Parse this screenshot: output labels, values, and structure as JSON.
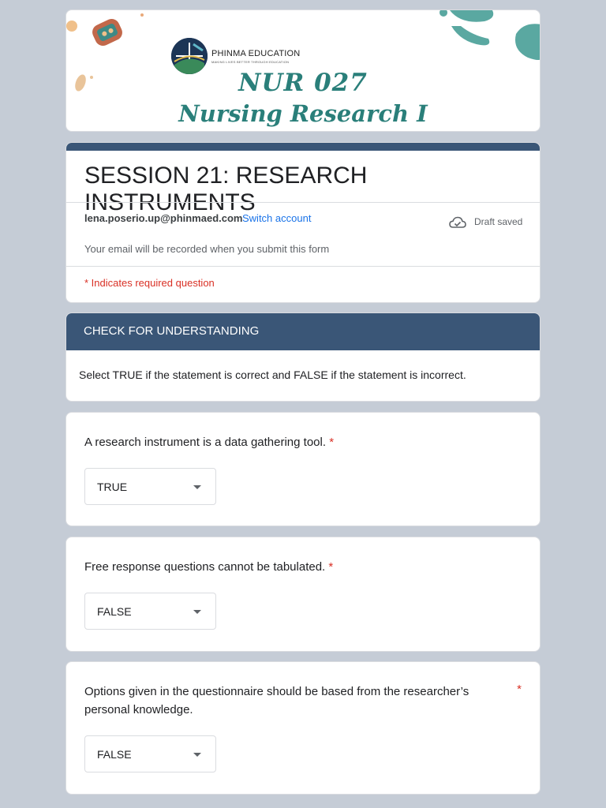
{
  "banner": {
    "org_name": "PHINMA EDUCATION",
    "org_tagline": "MAKING LIVES BETTER THROUGH EDUCATION",
    "course_code": "NUR 027",
    "course_name": "Nursing Research I"
  },
  "form": {
    "title": "SESSION 21: RESEARCH INSTRUMENTS",
    "account_email": "lena.poserio.up@phinmaed.com",
    "switch_account_label": "Switch account",
    "draft_status": "Draft saved",
    "email_notice": "Your email will be recorded when you submit this form",
    "required_notice": "* Indicates required question"
  },
  "section": {
    "title": "CHECK FOR UNDERSTANDING",
    "description": "Select TRUE if the statement is correct and FALSE if the statement is incorrect."
  },
  "questions": [
    {
      "text": "A research instrument is a data gathering tool.",
      "required_mark": "*",
      "selected": "TRUE"
    },
    {
      "text": "Free response questions cannot be tabulated.",
      "required_mark": "*",
      "selected": "FALSE"
    },
    {
      "text": "Options given in the questionnaire should be based from the researcher’s personal knowledge.",
      "required_mark": "*",
      "selected": "FALSE"
    }
  ],
  "colors": {
    "page_bg": "#c5ccd6",
    "header_accent": "#3a5677",
    "banner_teal": "#2a7f7a",
    "link_blue": "#1a73e8",
    "required_red": "#d93025"
  },
  "icons": {
    "draft_status": "cloud-check-icon",
    "dropdown": "caret-down-icon"
  }
}
